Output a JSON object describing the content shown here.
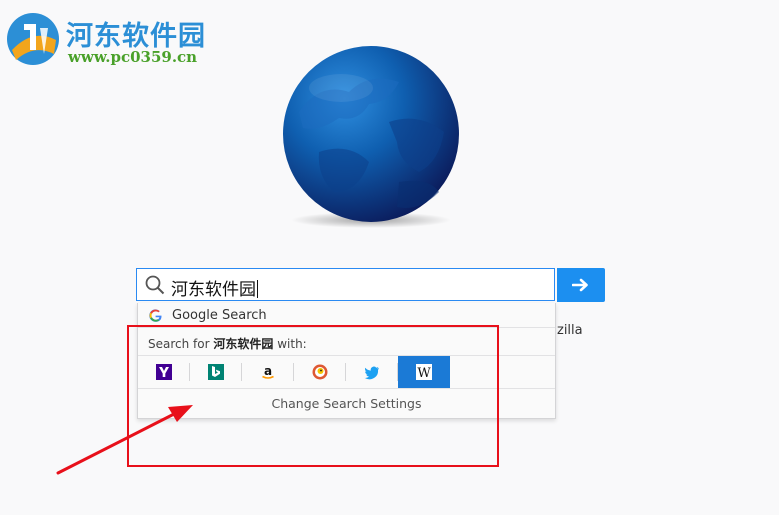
{
  "watermark": {
    "title": "河东软件园",
    "url": "www.pc0359.cn"
  },
  "search": {
    "value": "河东软件园",
    "go_icon": "right-arrow-icon"
  },
  "background_text": "zilla",
  "dropdown": {
    "suggestion": "Google Search",
    "search_for_prefix": "Search for",
    "search_for_term": "河东软件园",
    "search_for_suffix": "with:",
    "engines": [
      {
        "name": "Yahoo",
        "icon": "yahoo-icon",
        "selected": false
      },
      {
        "name": "Bing",
        "icon": "bing-icon",
        "selected": false
      },
      {
        "name": "Amazon",
        "icon": "amazon-icon",
        "selected": false
      },
      {
        "name": "DuckDuckGo",
        "icon": "duckduckgo-icon",
        "selected": false
      },
      {
        "name": "Twitter",
        "icon": "twitter-icon",
        "selected": false
      },
      {
        "name": "Wikipedia",
        "icon": "wikipedia-icon",
        "selected": true
      }
    ],
    "change_settings": "Change Search Settings"
  },
  "colors": {
    "accent": "#1c8ff0",
    "selected_engine": "#1b7ad6",
    "annotation": "#e8101a",
    "watermark_title": "#2c8fd6",
    "watermark_url": "#4aa12a"
  }
}
